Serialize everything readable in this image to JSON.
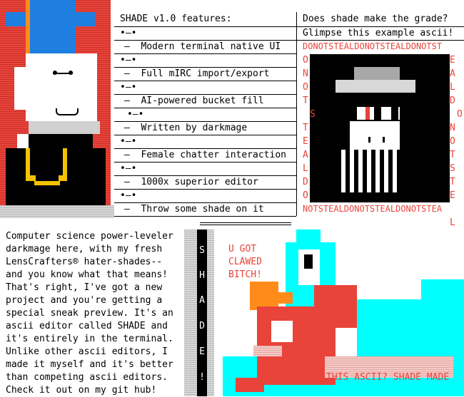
{
  "features_header": "SHADE v1.0 features:",
  "bullet": "•—•",
  "features": [
    "—  Modern terminal native UI",
    "—  Full mIRC import/export",
    "—  AI-powered bucket fill",
    "—  Written by darkmage",
    "—  Female chatter interaction",
    "—  1000x superior editor",
    "—  Throw some shade on it"
  ],
  "right_title": "Does shade make the grade?",
  "right_subtitle": "Glimpse this example ascii!",
  "banner_top": "DONOTSTEALDONOTSTEALDONOTST",
  "banner_bottom": "NOTSTEALDONOTSTEALDONOTSTEA",
  "left_col_letters": [
    "O",
    "N",
    "O",
    "T",
    "S",
    "T",
    "E",
    "A",
    "L",
    "D",
    "O"
  ],
  "right_col_letters": [
    "E",
    "A",
    "L",
    "D",
    "O",
    "N",
    "O",
    "T",
    "S",
    "T",
    "E"
  ],
  "overflow_letter": "L",
  "paragraph": [
    "Computer science power-leveler",
    "darkmage here, with my fresh",
    "LensCrafters® hater-shades--",
    "and you know what that means!",
    "That's right, I've got a new",
    "project and you're getting a",
    "special sneak preview. It's an",
    "ascii editor called SHADE and",
    "it's entirely in the terminal.",
    "Unlike other ascii editors, I",
    "made it myself and it's better",
    "than competing ascii editors.",
    "Check it out on my git hub!"
  ],
  "vertical_word": [
    "S",
    "H",
    "A",
    "D",
    "E",
    "!"
  ],
  "bird_caption": [
    "U GOT",
    "CLAWED",
    "BITCH!"
  ],
  "bottom_caption": "THIS ASCII? SHADE MADE",
  "colors": {
    "accent_red": "#e8443a",
    "cyan": "#00ffff",
    "orange": "#ff8c1a",
    "blue": "#1e7fe0",
    "gold": "#f2c200"
  }
}
